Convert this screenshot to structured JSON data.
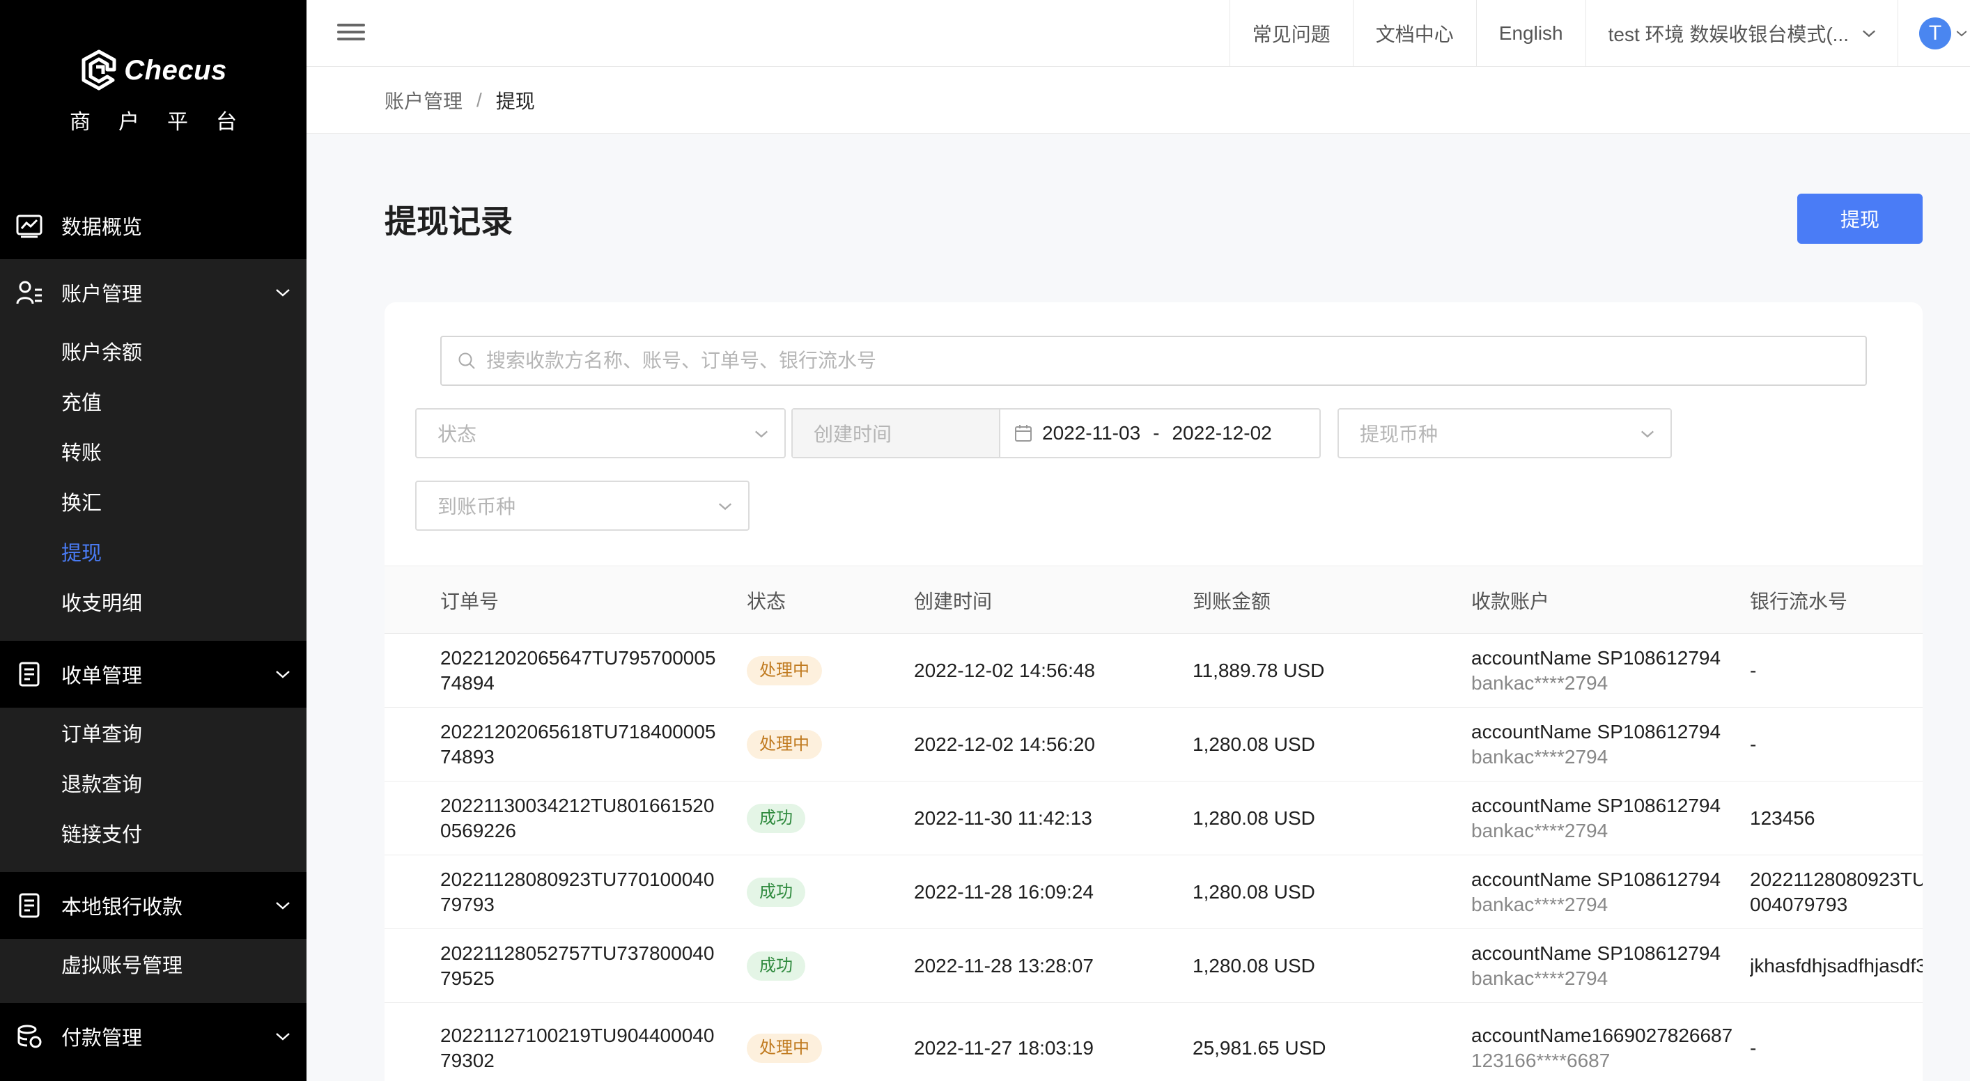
{
  "sidebar": {
    "brand_name": "Checus",
    "brand_subtitle": "商户平台",
    "overview_label": "数据概览",
    "groups": [
      {
        "label": "账户管理",
        "items": [
          "账户余额",
          "充值",
          "转账",
          "换汇",
          "提现",
          "收支明细"
        ]
      },
      {
        "label": "收单管理",
        "items": [
          "订单查询",
          "退款查询",
          "链接支付"
        ]
      },
      {
        "label": "本地银行收款",
        "items": [
          "虚拟账号管理"
        ]
      },
      {
        "label": "付款管理",
        "items": []
      }
    ],
    "active_item": "提现",
    "accent_color": "#4a7cf6"
  },
  "header": {
    "nav": [
      "常见问题",
      "文档中心",
      "English"
    ],
    "environment": "test 环境 数娱收银台模式(...",
    "avatar_letter": "T"
  },
  "breadcrumb": {
    "parent": "账户管理",
    "separator": "/",
    "current": "提现"
  },
  "page": {
    "title": "提现记录",
    "action_label": "提现"
  },
  "filters": {
    "search_placeholder": "搜索收款方名称、账号、订单号、银行流水号",
    "status_placeholder": "状态",
    "created_time_label": "创建时间",
    "date_start": "2022-11-03",
    "date_sep": "-",
    "date_end": "2022-12-02",
    "withdraw_currency_placeholder": "提现币种",
    "receive_currency_placeholder": "到账币种"
  },
  "table": {
    "columns": [
      "订单号",
      "状态",
      "创建时间",
      "到账金额",
      "收款账户",
      "银行流水号"
    ],
    "rows": [
      {
        "order": "20221202065647TU79570000574894",
        "status": "处理中",
        "status_type": "processing",
        "created": "2022-12-02 14:56:48",
        "amount": "11,889.78 USD",
        "account_name": "accountName SP108612794",
        "account_no": "bankac****2794",
        "bank_ref": "-"
      },
      {
        "order": "20221202065618TU71840000574893",
        "status": "处理中",
        "status_type": "processing",
        "created": "2022-12-02 14:56:20",
        "amount": "1,280.08 USD",
        "account_name": "accountName SP108612794",
        "account_no": "bankac****2794",
        "bank_ref": "-"
      },
      {
        "order": "20221130034212TU8016615200569226",
        "status": "成功",
        "status_type": "success",
        "created": "2022-11-30 11:42:13",
        "amount": "1,280.08 USD",
        "account_name": "accountName SP108612794",
        "account_no": "bankac****2794",
        "bank_ref": "123456"
      },
      {
        "order": "20221128080923TU77010004079793",
        "status": "成功",
        "status_type": "success",
        "created": "2022-11-28 16:09:24",
        "amount": "1,280.08 USD",
        "account_name": "accountName SP108612794",
        "account_no": "bankac****2794",
        "bank_ref": "20221128080923TU",
        "bank_ref_line2": "004079793"
      },
      {
        "order": "20221128052757TU73780004079525",
        "status": "成功",
        "status_type": "success",
        "created": "2022-11-28 13:28:07",
        "amount": "1,280.08 USD",
        "account_name": "accountName SP108612794",
        "account_no": "bankac****2794",
        "bank_ref": "jkhasfdhjsadfhjasdf3"
      },
      {
        "order": "20221127100219TU90440004079302",
        "status": "处理中",
        "status_type": "processing",
        "created": "2022-11-27 18:03:19",
        "amount": "25,981.65 USD",
        "account_name": "accountName1669027826687",
        "account_no": "123166****6687",
        "bank_ref": "-"
      }
    ]
  }
}
